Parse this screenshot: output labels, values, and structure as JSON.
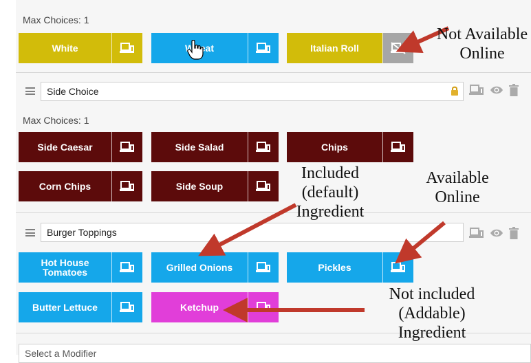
{
  "group1": {
    "max_label": "Max Choices: 1",
    "buttons": [
      {
        "label": "White",
        "color": "#d2bc0a"
      },
      {
        "label": "Wheat",
        "color": "#15a7ea"
      },
      {
        "label": "Italian Roll",
        "color": "#d2bc0a"
      }
    ]
  },
  "group2": {
    "name_value": "Side Choice",
    "max_label": "Max Choices: 1",
    "buttons": [
      {
        "label": "Side Caesar"
      },
      {
        "label": "Side Salad"
      },
      {
        "label": "Chips"
      },
      {
        "label": "Corn Chips"
      },
      {
        "label": "Side Soup"
      }
    ],
    "color": "#5c0b0b"
  },
  "group3": {
    "name_value": "Burger Toppings",
    "buttons": [
      {
        "label": "Hot House Tomatoes",
        "color": "#15a7ea"
      },
      {
        "label": "Grilled Onions",
        "color": "#15a7ea"
      },
      {
        "label": "Pickles",
        "color": "#15a7ea"
      },
      {
        "label": "Butter Lettuce",
        "color": "#15a7ea"
      },
      {
        "label": "Ketchup",
        "color": "#e13ed9"
      }
    ]
  },
  "select_placeholder": "Select a Modifier",
  "annotations": {
    "not_available": "Not Available Online",
    "included": "Included (default) Ingredient",
    "available": "Available Online",
    "not_included": "Not included (Addable) Ingredient"
  },
  "icons": {
    "device": "device-icon",
    "device_off": "device-off-icon",
    "lock": "lock-icon",
    "eye": "eye-icon",
    "trash": "trash-icon",
    "drag": "drag-handle-icon",
    "cursor": "hand-cursor-icon"
  },
  "colors": {
    "yellow": "#d2bc0a",
    "blue": "#15a7ea",
    "maroon": "#5c0b0b",
    "magenta": "#e13ed9",
    "unavailable_gray": "#a6a6a6",
    "arrow": "#c0392b"
  }
}
